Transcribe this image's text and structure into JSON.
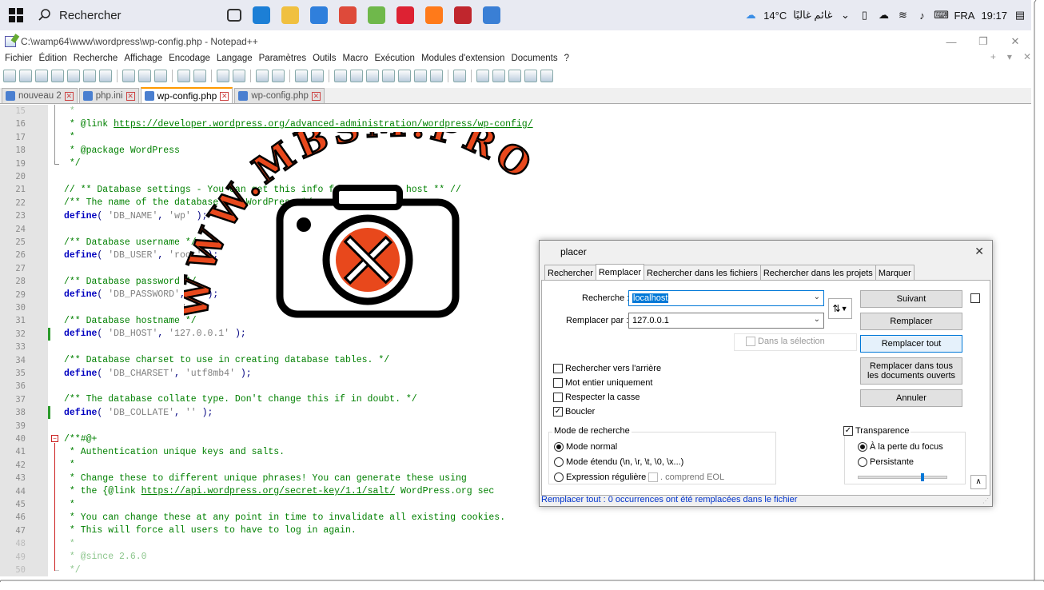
{
  "taskbar": {
    "search_placeholder": "Rechercher",
    "weather": "14°C",
    "weather_text": "غائم غالبًا",
    "language": "FRA",
    "time": "19:17",
    "apps": [
      {
        "name": "task-view",
        "color": "#e8eaf2"
      },
      {
        "name": "edge",
        "color": "#1c7fd6"
      },
      {
        "name": "file-manager",
        "color": "#f0c040"
      },
      {
        "name": "store",
        "color": "#2f7fdc"
      },
      {
        "name": "chrome",
        "color": "#de4a3a"
      },
      {
        "name": "notepadpp",
        "color": "#6fb84b"
      },
      {
        "name": "app-red",
        "color": "#d23"
      },
      {
        "name": "firefox",
        "color": "#ff7a1a"
      },
      {
        "name": "filezilla",
        "color": "#c0262d"
      },
      {
        "name": "app-blue",
        "color": "#3a7fd5"
      }
    ]
  },
  "window": {
    "title": "C:\\wamp64\\www\\wordpress\\wp-config.php - Notepad++"
  },
  "menu": [
    "Fichier",
    "Édition",
    "Recherche",
    "Affichage",
    "Encodage",
    "Langage",
    "Paramètres",
    "Outils",
    "Macro",
    "Exécution",
    "Modules d'extension",
    "Documents",
    "?"
  ],
  "tabs": [
    {
      "label": "nouveau 2",
      "active": false
    },
    {
      "label": "php.ini",
      "active": false
    },
    {
      "label": "wp-config.php",
      "active": true
    },
    {
      "label": "wp-config.php",
      "active": false
    }
  ],
  "editor": {
    "lines": [
      {
        "n": "15",
        "tokens": [
          [
            "c",
            " *"
          ]
        ],
        "faded": true
      },
      {
        "n": "16",
        "tokens": [
          [
            "c",
            " * @link "
          ],
          [
            "l",
            "https://developer.wordpress.org/advanced-administration/wordpress/wp-config/"
          ]
        ]
      },
      {
        "n": "17",
        "tokens": [
          [
            "c",
            " *"
          ]
        ]
      },
      {
        "n": "18",
        "tokens": [
          [
            "c",
            " * @package WordPress"
          ]
        ]
      },
      {
        "n": "19",
        "tokens": [
          [
            "c",
            " */"
          ]
        ],
        "foldEnd": true
      },
      {
        "n": "20",
        "tokens": []
      },
      {
        "n": "21",
        "tokens": [
          [
            "c",
            "// ** Database settings - You can get this info from your web host ** //"
          ]
        ]
      },
      {
        "n": "22",
        "tokens": [
          [
            "c",
            "/** The name of the database for WordPress */"
          ]
        ]
      },
      {
        "n": "23",
        "tokens": [
          [
            "k",
            "define"
          ],
          [
            "o",
            "( "
          ],
          [
            "s",
            "'DB_NAME'"
          ],
          [
            "o",
            ", "
          ],
          [
            "s",
            "'wp'"
          ],
          [
            "o",
            " );"
          ]
        ]
      },
      {
        "n": "24",
        "tokens": []
      },
      {
        "n": "25",
        "tokens": [
          [
            "c",
            "/** Database username */"
          ]
        ]
      },
      {
        "n": "26",
        "tokens": [
          [
            "k",
            "define"
          ],
          [
            "o",
            "( "
          ],
          [
            "s",
            "'DB_USER'"
          ],
          [
            "o",
            ", "
          ],
          [
            "s",
            "'root'"
          ],
          [
            "o",
            " );"
          ]
        ]
      },
      {
        "n": "27",
        "tokens": []
      },
      {
        "n": "28",
        "tokens": [
          [
            "c",
            "/** Database password */"
          ]
        ]
      },
      {
        "n": "29",
        "tokens": [
          [
            "k",
            "define"
          ],
          [
            "o",
            "( "
          ],
          [
            "s",
            "'DB_PASSWORD'"
          ],
          [
            "o",
            ", "
          ],
          [
            "s",
            "''"
          ],
          [
            "o",
            " );"
          ]
        ]
      },
      {
        "n": "30",
        "tokens": []
      },
      {
        "n": "31",
        "tokens": [
          [
            "c",
            "/** Database hostname */"
          ]
        ]
      },
      {
        "n": "32",
        "tokens": [
          [
            "k",
            "define"
          ],
          [
            "o",
            "( "
          ],
          [
            "s",
            "'DB_HOST'"
          ],
          [
            "o",
            ", "
          ],
          [
            "s",
            "'127.0.0.1'"
          ],
          [
            "o",
            " );"
          ]
        ],
        "changed": true
      },
      {
        "n": "33",
        "tokens": []
      },
      {
        "n": "34",
        "tokens": [
          [
            "c",
            "/** Database charset to use in creating database tables. */"
          ]
        ]
      },
      {
        "n": "35",
        "tokens": [
          [
            "k",
            "define"
          ],
          [
            "o",
            "( "
          ],
          [
            "s",
            "'DB_CHARSET'"
          ],
          [
            "o",
            ", "
          ],
          [
            "s",
            "'utf8mb4'"
          ],
          [
            "o",
            " );"
          ]
        ]
      },
      {
        "n": "36",
        "tokens": []
      },
      {
        "n": "37",
        "tokens": [
          [
            "c",
            "/** The database collate type. Don't change this if in doubt. */"
          ]
        ]
      },
      {
        "n": "38",
        "tokens": [
          [
            "k",
            "define"
          ],
          [
            "o",
            "( "
          ],
          [
            "s",
            "'DB_COLLATE'"
          ],
          [
            "o",
            ", "
          ],
          [
            "s",
            "''"
          ],
          [
            "o",
            " );"
          ]
        ],
        "changed": true
      },
      {
        "n": "39",
        "tokens": []
      },
      {
        "n": "40",
        "tokens": [
          [
            "c",
            "/**#@+"
          ]
        ],
        "foldStart": true
      },
      {
        "n": "41",
        "tokens": [
          [
            "c",
            " * Authentication unique keys and salts."
          ]
        ]
      },
      {
        "n": "42",
        "tokens": [
          [
            "c",
            " *"
          ]
        ]
      },
      {
        "n": "43",
        "tokens": [
          [
            "c",
            " * Change these to different unique phrases! You can generate these using"
          ]
        ]
      },
      {
        "n": "44",
        "tokens": [
          [
            "c",
            " * the {@link "
          ],
          [
            "l",
            "https://api.wordpress.org/secret-key/1.1/salt/"
          ],
          [
            "c",
            " WordPress.org sec"
          ]
        ]
      },
      {
        "n": "45",
        "tokens": [
          [
            "c",
            " *"
          ]
        ]
      },
      {
        "n": "46",
        "tokens": [
          [
            "c",
            " * You can change these at any point in time to invalidate all existing cookies."
          ]
        ]
      },
      {
        "n": "47",
        "tokens": [
          [
            "c",
            " * This will force all users to have to log in again."
          ]
        ]
      },
      {
        "n": "48",
        "tokens": [
          [
            "c",
            " *"
          ]
        ],
        "faded": true
      },
      {
        "n": "49",
        "tokens": [
          [
            "c",
            " * @since 2.6.0"
          ]
        ],
        "faded": true
      },
      {
        "n": "50",
        "tokens": [
          [
            "c",
            " */"
          ]
        ],
        "faded": true,
        "foldEnd": true
      }
    ]
  },
  "watermark": {
    "text": "WWW.MBSM.PRO"
  },
  "dialog": {
    "title": "placer",
    "tabs": [
      "Rechercher",
      "Remplacer",
      "Rechercher dans les fichiers",
      "Rechercher dans les projets",
      "Marquer"
    ],
    "search_label": "Recherche :",
    "search_value": "localhost",
    "replace_label": "Remplacer par :",
    "replace_value": "127.0.0.1",
    "in_selection": "Dans la sélection",
    "btn_next": "Suivant",
    "btn_replace": "Remplacer",
    "btn_replace_all": "Remplacer tout",
    "btn_replace_all_docs": "Remplacer dans tous les documents ouverts",
    "btn_cancel": "Annuler",
    "opt_backward": "Rechercher vers l'arrière",
    "opt_whole_word": "Mot entier uniquement",
    "opt_case": "Respecter la casse",
    "opt_wrap": "Boucler",
    "mode_title": "Mode de recherche",
    "mode_normal": "Mode normal",
    "mode_extended": "Mode étendu (\\n, \\r, \\t, \\0, \\x...)",
    "mode_regex": "Expression régulière",
    "matches_newline": ". comprend EOL",
    "transparency_title": "Transparence",
    "trans_on_lose_focus": "À la perte du focus",
    "trans_always": "Persistante",
    "swap_glyph": "⇅",
    "status": "Remplacer tout : 0 occurrences ont été remplacées dans le fichier",
    "transparency_level": 0.72
  }
}
